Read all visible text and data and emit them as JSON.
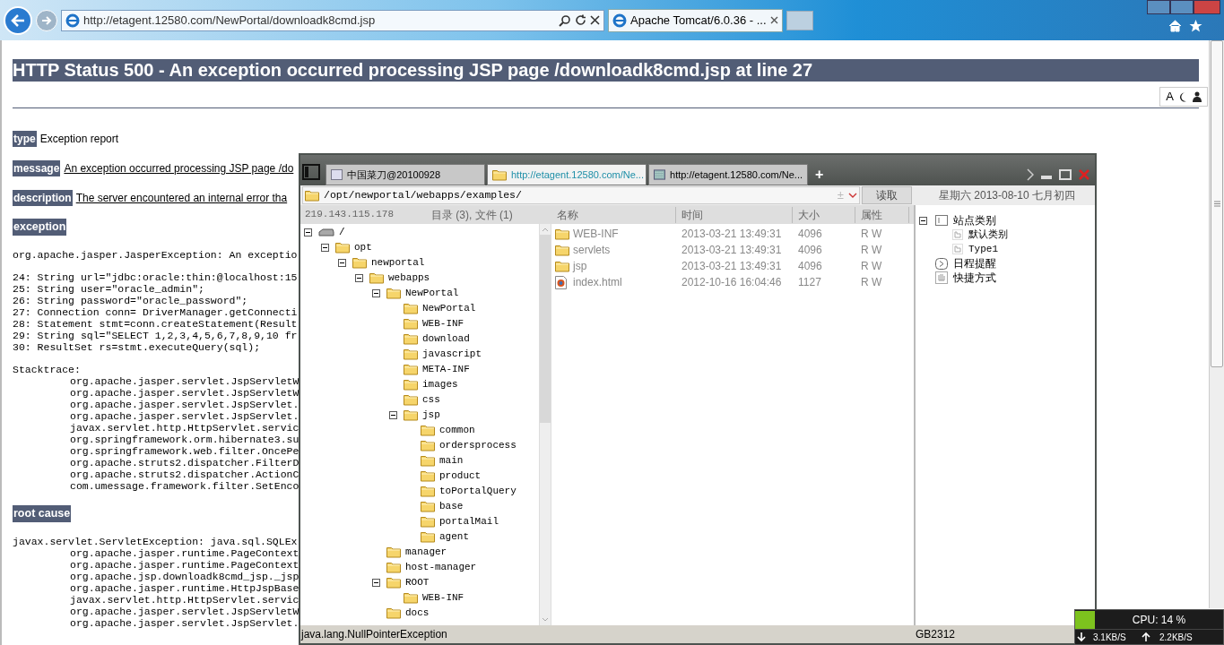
{
  "browser": {
    "address": "http://etagent.12580.com/NewPortal/downloadk8cmd.jsp",
    "tabs": [
      {
        "title": "Apache Tomcat/6.0.36 - ...",
        "selected": true
      }
    ]
  },
  "page": {
    "heading": "HTTP Status 500 - An exception occurred processing JSP page /downloadk8cmd.jsp at line 27",
    "toolbar_letter": "A",
    "blocks": [
      {
        "kind": "field",
        "label": "type",
        "text": "Exception report",
        "underlined": false
      },
      {
        "kind": "field",
        "label": "message",
        "text": "An exception occurred processing JSP page /do",
        "underlined": true
      },
      {
        "kind": "field",
        "label": "description",
        "text": "The server encountered an internal error tha",
        "underlined": true
      },
      {
        "kind": "heading",
        "label": "exception"
      },
      {
        "kind": "code",
        "lines": [
          {
            "text": "org.apache.jasper.JasperException: An exceptio"
          }
        ]
      },
      {
        "kind": "code",
        "lines": [
          {
            "text": "24: String url=\"jdbc:oracle:thin:@localhost:15"
          },
          {
            "text": "25: String user=\"oracle_admin\";"
          },
          {
            "text": "26: String password=\"oracle_password\";"
          },
          {
            "text": "27: Connection conn= DriverManager.getConnecti"
          },
          {
            "text": "28: Statement stmt=conn.createStatement(Result"
          },
          {
            "text": "29: String sql=\"SELECT 1,2,3,4,5,6,7,8,9,10 fr"
          },
          {
            "text": "30: ResultSet rs=stmt.executeQuery(sql);"
          }
        ]
      },
      {
        "kind": "code",
        "lines": [
          {
            "text": "Stacktrace:",
            "children": [
              {
                "text": "org.apache.jasper.servlet.JspServletW"
              },
              {
                "text": "org.apache.jasper.servlet.JspServletW"
              },
              {
                "text": "org.apache.jasper.servlet.JspServlet."
              },
              {
                "text": "org.apache.jasper.servlet.JspServlet."
              },
              {
                "text": "javax.servlet.http.HttpServlet.servic"
              },
              {
                "text": "org.springframework.orm.hibernate3.su"
              },
              {
                "text": "org.springframework.web.filter.OncePe"
              },
              {
                "text": "org.apache.struts2.dispatcher.FilterD"
              },
              {
                "text": "org.apache.struts2.dispatcher.ActionC"
              },
              {
                "text": "com.umessage.framework.filter.SetEnco"
              }
            ]
          }
        ]
      },
      {
        "kind": "heading",
        "label": "root cause"
      },
      {
        "kind": "code",
        "lines": [
          {
            "text": "javax.servlet.ServletException: java.sql.SQLEx",
            "children": [
              {
                "text": "org.apache.jasper.runtime.PageContext"
              },
              {
                "text": "org.apache.jasper.runtime.PageContext"
              },
              {
                "text": "org.apache.jsp.downloadk8cmd_jsp._jsp"
              },
              {
                "text": "org.apache.jasper.runtime.HttpJspBase"
              },
              {
                "text": "javax.servlet.http.HttpServlet.servic"
              },
              {
                "text": "org.apache.jasper.servlet.JspServletW"
              },
              {
                "text": "org.apache.jasper.servlet.JspServlet."
              }
            ]
          }
        ]
      }
    ]
  },
  "file_manager": {
    "tabs": [
      {
        "title": "中国菜刀@20100928",
        "kind": "home",
        "selected": false
      },
      {
        "title": "http://etagent.12580.com/Ne...",
        "kind": "folder",
        "selected": true
      },
      {
        "title": "http://etagent.12580.com/Ne...",
        "kind": "terminal",
        "selected": false
      }
    ],
    "new_tab": "+",
    "path": "/opt/newportal/webapps/examples/",
    "path_toggle": "±",
    "read_button": "读取",
    "date": "星期六 2013-08-10 七月初四",
    "host": "219.143.115.178",
    "summary": "目录 (3), 文件 (1)",
    "columns": [
      "名称",
      "时间",
      "大小",
      "属性"
    ],
    "tree": [
      {
        "name": "/",
        "kind": "drive",
        "expanded": true,
        "children": [
          {
            "name": "opt",
            "kind": "folder",
            "expanded": true,
            "children": [
              {
                "name": "newportal",
                "kind": "folder",
                "expanded": true,
                "children": [
                  {
                    "name": "webapps",
                    "kind": "folder",
                    "expanded": true,
                    "children": [
                      {
                        "name": "NewPortal",
                        "kind": "folder",
                        "expanded": true,
                        "children": [
                          {
                            "name": "NewPortal",
                            "kind": "folder"
                          },
                          {
                            "name": "WEB-INF",
                            "kind": "folder"
                          },
                          {
                            "name": "download",
                            "kind": "folder"
                          },
                          {
                            "name": "javascript",
                            "kind": "folder"
                          },
                          {
                            "name": "META-INF",
                            "kind": "folder"
                          },
                          {
                            "name": "images",
                            "kind": "folder"
                          },
                          {
                            "name": "css",
                            "kind": "folder"
                          },
                          {
                            "name": "jsp",
                            "kind": "folder",
                            "expanded": true,
                            "children": [
                              {
                                "name": "common",
                                "kind": "folder"
                              },
                              {
                                "name": "ordersprocess",
                                "kind": "folder"
                              },
                              {
                                "name": "main",
                                "kind": "folder"
                              },
                              {
                                "name": "product",
                                "kind": "folder"
                              },
                              {
                                "name": "toPortalQuery",
                                "kind": "folder"
                              },
                              {
                                "name": "base",
                                "kind": "folder"
                              },
                              {
                                "name": "portalMail",
                                "kind": "folder"
                              },
                              {
                                "name": "agent",
                                "kind": "folder"
                              }
                            ]
                          }
                        ]
                      },
                      {
                        "name": "manager",
                        "kind": "folder"
                      },
                      {
                        "name": "host-manager",
                        "kind": "folder"
                      },
                      {
                        "name": "ROOT",
                        "kind": "folder",
                        "expanded": true,
                        "children": [
                          {
                            "name": "WEB-INF",
                            "kind": "folder"
                          }
                        ]
                      },
                      {
                        "name": "docs",
                        "kind": "folder"
                      }
                    ]
                  }
                ]
              }
            ]
          }
        ]
      }
    ],
    "files": [
      {
        "name": "WEB-INF",
        "time": "2013-03-21 13:49:31",
        "size": "4096",
        "attr": "R W",
        "kind": "folder"
      },
      {
        "name": "servlets",
        "time": "2013-03-21 13:49:31",
        "size": "4096",
        "attr": "R W",
        "kind": "folder"
      },
      {
        "name": "jsp",
        "time": "2013-03-21 13:49:31",
        "size": "4096",
        "attr": "R W",
        "kind": "folder"
      },
      {
        "name": "index.html",
        "time": "2012-10-16 16:04:46",
        "size": "1127",
        "attr": "R W",
        "kind": "html"
      }
    ],
    "side_tree": [
      {
        "name": "站点类别",
        "kind": "category",
        "expanded": true,
        "children": [
          {
            "name": "默认类别",
            "kind": "type"
          },
          {
            "name": "Type1",
            "kind": "type"
          }
        ]
      },
      {
        "name": "日程提醒",
        "kind": "schedule"
      },
      {
        "name": "快捷方式",
        "kind": "shortcut"
      }
    ],
    "status": "java.lang.NullPointerException",
    "encoding": "GB2312"
  },
  "monitor": {
    "cpu": "CPU: 14 %",
    "down": "3.1KB/S",
    "up": "2.2KB/S"
  }
}
